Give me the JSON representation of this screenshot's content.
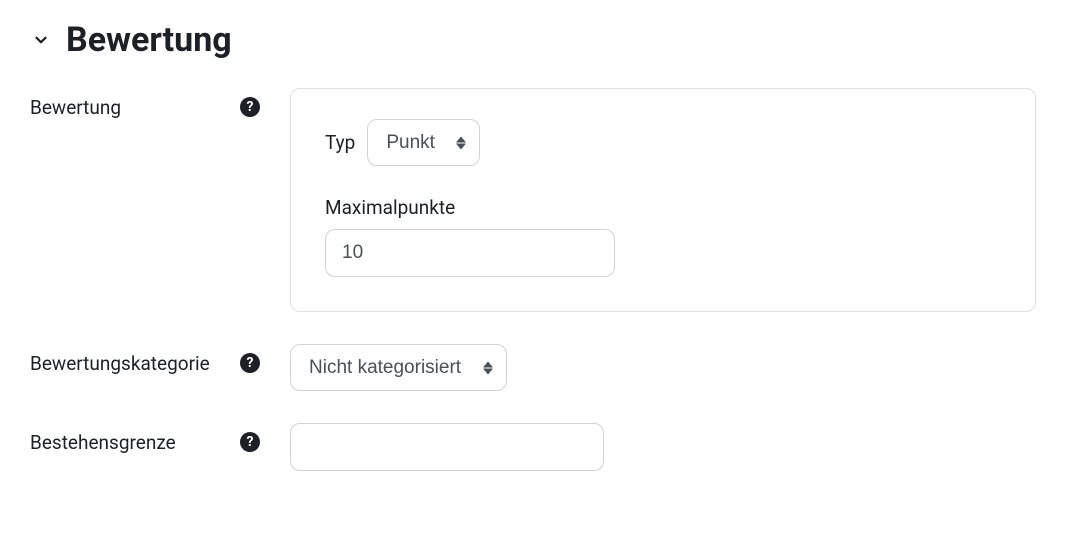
{
  "section": {
    "title": "Bewertung"
  },
  "grade": {
    "label": "Bewertung",
    "type_label": "Typ",
    "type_value": "Punkt",
    "maxpoints_label": "Maximalpunkte",
    "maxpoints_value": "10"
  },
  "category": {
    "label": "Bewertungskategorie",
    "value": "Nicht kategorisiert"
  },
  "gradepass": {
    "label": "Bestehensgrenze",
    "value": ""
  }
}
